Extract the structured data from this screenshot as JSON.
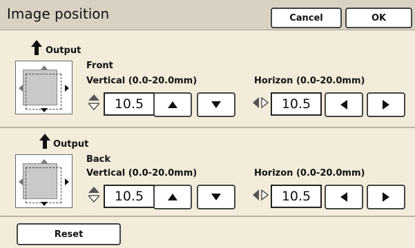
{
  "title": "Image position",
  "buttons": {
    "cancel": "Cancel",
    "ok": "OK",
    "reset": "Reset"
  },
  "front": {
    "output_label": "Output",
    "side_label": "Front",
    "vertical_label": "Vertical (0.0-20.0mm)",
    "vertical_value": "10.5",
    "horizon_label": "Horizon (0.0-20.0mm)",
    "horizon_value": "10.5"
  },
  "back": {
    "output_label": "Output",
    "side_label": "Back",
    "vertical_label": "Vertical (0.0-20.0mm)",
    "vertical_value": "10.5",
    "horizon_label": "Horizon (0.0-20.0mm)",
    "horizon_value": "10.5"
  },
  "icons": {
    "output": "up-arrow-icon",
    "vertical": "updown-icon",
    "horizon": "leftright-icon",
    "up": "triangle-up-icon",
    "down": "triangle-down-icon",
    "left": "triangle-left-icon",
    "right": "triangle-right-icon"
  }
}
